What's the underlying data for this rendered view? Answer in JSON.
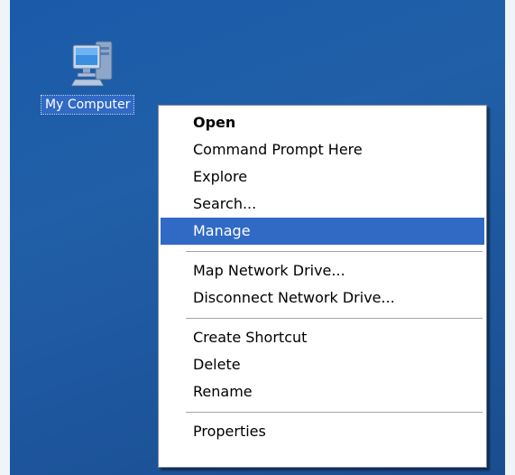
{
  "desktop": {
    "icon": {
      "label": "My Computer",
      "icon_name": "computer-icon"
    }
  },
  "context_menu": {
    "groups": [
      [
        {
          "label": "Open",
          "bold": true
        },
        {
          "label": "Command Prompt Here"
        },
        {
          "label": "Explore"
        },
        {
          "label": "Search..."
        },
        {
          "label": "Manage",
          "highlighted": true
        }
      ],
      [
        {
          "label": "Map Network Drive..."
        },
        {
          "label": "Disconnect Network Drive..."
        }
      ],
      [
        {
          "label": "Create Shortcut"
        },
        {
          "label": "Delete"
        },
        {
          "label": "Rename"
        }
      ],
      [
        {
          "label": "Properties"
        }
      ]
    ]
  },
  "colors": {
    "desktop_background": "#215fa8",
    "selection": "#316ac5",
    "menu_background": "#ffffff"
  }
}
